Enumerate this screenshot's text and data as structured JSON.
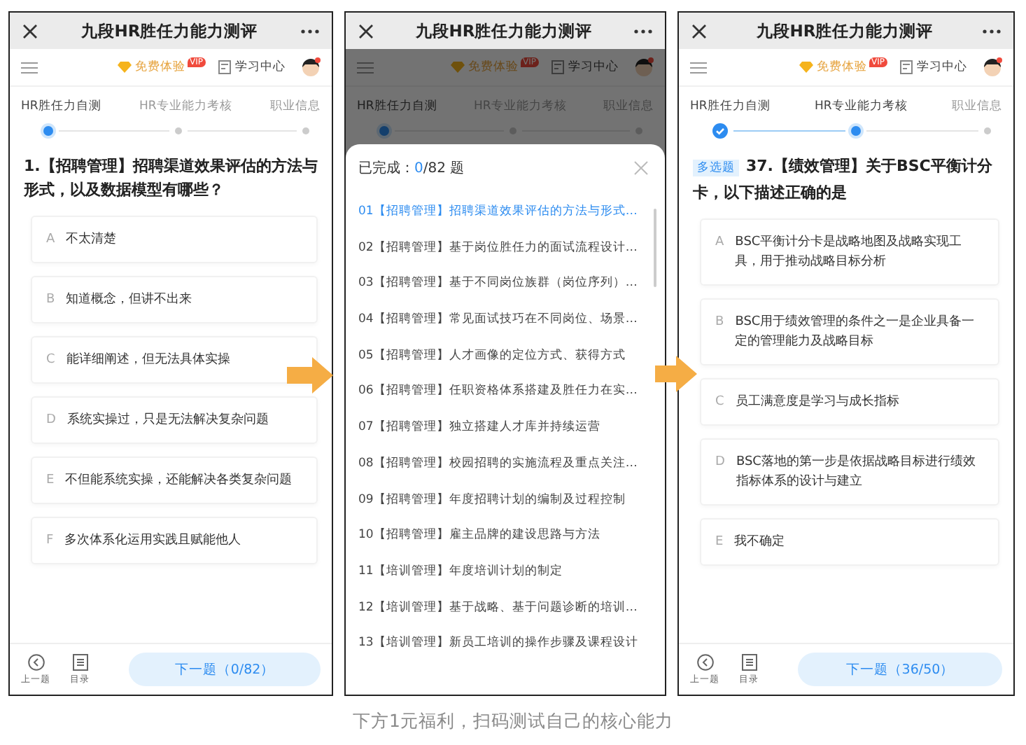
{
  "screens": [
    {
      "kind": "quiz",
      "title": "九段HR胜任力能力测评",
      "trial": "免费体验",
      "vip": "VIP",
      "study": "学习中心",
      "steps": [
        {
          "label": "HR胜任力自测",
          "selected": true,
          "done": false
        },
        {
          "label": "HR专业能力考核",
          "selected": false,
          "done": false
        },
        {
          "label": "职业信息",
          "selected": false,
          "done": false
        }
      ],
      "question": {
        "text": "1.【招聘管理】招聘渠道效果评估的方法与形式，以及数据模型有哪些？"
      },
      "options": [
        {
          "letter": "A",
          "text": "不太清楚"
        },
        {
          "letter": "B",
          "text": "知道概念，但讲不出来"
        },
        {
          "letter": "C",
          "text": "能详细阐述，但无法具体实操"
        },
        {
          "letter": "D",
          "text": "系统实操过，只是无法解决复杂问题"
        },
        {
          "letter": "E",
          "text": "不但能系统实操，还能解决各类复杂问题"
        },
        {
          "letter": "F",
          "text": "多次体系化运用实践且赋能他人"
        }
      ],
      "prev": "上一题",
      "catalog": "目录",
      "next": "下一题（0/82）"
    },
    {
      "kind": "catalog",
      "title": "九段HR胜任力能力测评",
      "trial": "免费体验",
      "vip": "VIP",
      "study": "学习中心",
      "steps": [
        {
          "label": "HR胜任力自测",
          "selected": true,
          "done": false
        },
        {
          "label": "HR专业能力考核",
          "selected": false,
          "done": false
        },
        {
          "label": "职业信息",
          "selected": false,
          "done": false
        }
      ],
      "sheet": {
        "label": "已完成：",
        "done": "0",
        "total": "/82 题",
        "items": [
          {
            "text": "01【招聘管理】招聘渠道效果评估的方法与形式…",
            "selected": true
          },
          {
            "text": "02【招聘管理】基于岗位胜任力的面试流程设计…",
            "selected": false
          },
          {
            "text": "03【招聘管理】基于不同岗位族群（岗位序列）…",
            "selected": false
          },
          {
            "text": "04【招聘管理】常见面试技巧在不同岗位、场景…",
            "selected": false
          },
          {
            "text": "05【招聘管理】人才画像的定位方式、获得方式",
            "selected": false
          },
          {
            "text": "06【招聘管理】任职资格体系搭建及胜任力在实…",
            "selected": false
          },
          {
            "text": "07【招聘管理】独立搭建人才库并持续运营",
            "selected": false
          },
          {
            "text": "08【招聘管理】校园招聘的实施流程及重点关注…",
            "selected": false
          },
          {
            "text": "09【招聘管理】年度招聘计划的编制及过程控制",
            "selected": false
          },
          {
            "text": "10【招聘管理】雇主品牌的建设思路与方法",
            "selected": false
          },
          {
            "text": "11【培训管理】年度培训计划的制定",
            "selected": false
          },
          {
            "text": "12【培训管理】基于战略、基于问题诊断的培训…",
            "selected": false
          },
          {
            "text": "13【培训管理】新员工培训的操作步骤及课程设计",
            "selected": false
          }
        ]
      }
    },
    {
      "kind": "quiz",
      "title": "九段HR胜任力能力测评",
      "trial": "免费体验",
      "vip": "VIP",
      "study": "学习中心",
      "steps": [
        {
          "label": "HR胜任力自测",
          "selected": false,
          "done": true
        },
        {
          "label": "HR专业能力考核",
          "selected": true,
          "done": false
        },
        {
          "label": "职业信息",
          "selected": false,
          "done": false
        }
      ],
      "question": {
        "tag": "多选题",
        "text": "37.【绩效管理】关于BSC平衡计分卡，以下描述正确的是"
      },
      "options": [
        {
          "letter": "A",
          "text": "BSC平衡计分卡是战略地图及战略实现工具，用于推动战略目标分析"
        },
        {
          "letter": "B",
          "text": "BSC用于绩效管理的条件之一是企业具备一定的管理能力及战略目标"
        },
        {
          "letter": "C",
          "text": "员工满意度是学习与成长指标"
        },
        {
          "letter": "D",
          "text": "BSC落地的第一步是依据战略目标进行绩效指标体系的设计与建立"
        },
        {
          "letter": "E",
          "text": "我不确定"
        }
      ],
      "prev": "上一题",
      "catalog": "目录",
      "next": "下一题（36/50）"
    }
  ],
  "caption": "下方1元福利，扫码测试自己的核心能力"
}
